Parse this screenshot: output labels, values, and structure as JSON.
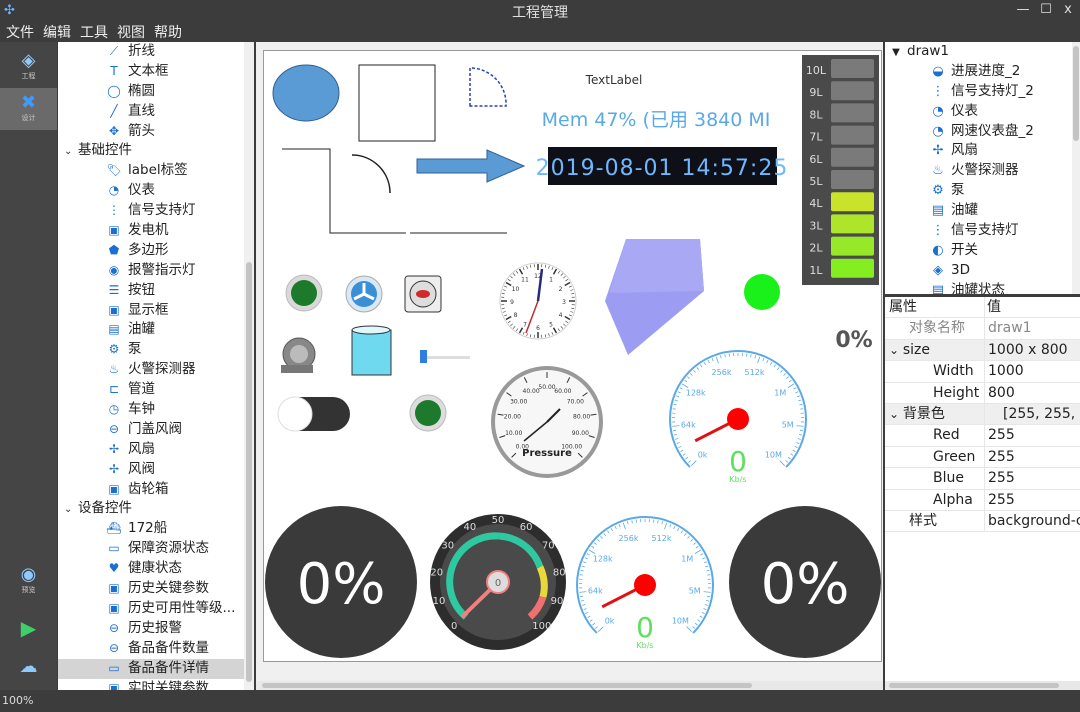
{
  "window": {
    "title": "工程管理",
    "minimize": "—",
    "maximize": "☐",
    "close": "x"
  },
  "menu": [
    "文件",
    "编辑",
    "工具",
    "视图",
    "帮助"
  ],
  "leftbar": {
    "project_label": "工程",
    "design_label": "设计",
    "preview_label": "预览"
  },
  "toolbox": {
    "items": [
      {
        "label": "折线",
        "icon": "polyline-icon",
        "glyph": "⟋"
      },
      {
        "label": "文本框",
        "icon": "textbox-icon",
        "glyph": "T"
      },
      {
        "label": "椭圆",
        "icon": "ellipse-icon",
        "glyph": "◯"
      },
      {
        "label": "直线",
        "icon": "line-icon",
        "glyph": "╱"
      },
      {
        "label": "箭头",
        "icon": "arrow-icon",
        "glyph": "✥"
      }
    ],
    "basic_category": "基础控件",
    "basic_items": [
      {
        "label": "label标签",
        "icon": "tag-icon",
        "glyph": "🏷"
      },
      {
        "label": "仪表",
        "icon": "gauge-icon",
        "glyph": "◔"
      },
      {
        "label": "信号支持灯",
        "icon": "signal-light-icon",
        "glyph": "⋮"
      },
      {
        "label": "发电机",
        "icon": "generator-icon",
        "glyph": "▣"
      },
      {
        "label": "多边形",
        "icon": "polygon-icon",
        "glyph": "⬟"
      },
      {
        "label": "报警指示灯",
        "icon": "alarm-light-icon",
        "glyph": "◉"
      },
      {
        "label": "按钮",
        "icon": "button-list-icon",
        "glyph": "☰"
      },
      {
        "label": "显示框",
        "icon": "display-box-icon",
        "glyph": "▣"
      },
      {
        "label": "油罐",
        "icon": "tank-icon",
        "glyph": "▤"
      },
      {
        "label": "泵",
        "icon": "pump-icon",
        "glyph": "⚙"
      },
      {
        "label": "火警探测器",
        "icon": "fire-icon",
        "glyph": "♨"
      },
      {
        "label": "管道",
        "icon": "pipe-icon",
        "glyph": "⊏"
      },
      {
        "label": "车钟",
        "icon": "clock-icon",
        "glyph": "◷"
      },
      {
        "label": "门盖风阀",
        "icon": "damper-icon",
        "glyph": "⊖"
      },
      {
        "label": "风扇",
        "icon": "fan-icon",
        "glyph": "✢"
      },
      {
        "label": "风阀",
        "icon": "valve-icon",
        "glyph": "✢"
      },
      {
        "label": "齿轮箱",
        "icon": "gearbox-icon",
        "glyph": "▣"
      }
    ],
    "device_category": "设备控件",
    "device_items": [
      {
        "label": "172船",
        "icon": "ship-icon",
        "glyph": "⛴"
      },
      {
        "label": "保障资源状态",
        "icon": "chart-icon",
        "glyph": "▭"
      },
      {
        "label": "健康状态",
        "icon": "heart-icon",
        "glyph": "♥"
      },
      {
        "label": "历史关键参数",
        "icon": "history-icon",
        "glyph": "▣"
      },
      {
        "label": "历史可用性等级...",
        "icon": "history-icon",
        "glyph": "▣"
      },
      {
        "label": "历史报警",
        "icon": "alarm-history-icon",
        "glyph": "⊖"
      },
      {
        "label": "备品备件数量",
        "icon": "spare-count-icon",
        "glyph": "⊖"
      },
      {
        "label": "备品备件详情",
        "icon": "spare-detail-icon",
        "glyph": "▭"
      },
      {
        "label": "实时关键参数",
        "icon": "realtime-icon",
        "glyph": "▣"
      }
    ]
  },
  "canvas": {
    "text_label": "TextLabel",
    "mem_text": "Mem 47% (已用 3840 MI",
    "digital_clock": "2019-08-01 14:57:25",
    "led_levels": [
      "10L",
      "9L",
      "8L",
      "7L",
      "6L",
      "5L",
      "4L",
      "3L",
      "2L",
      "1L"
    ],
    "led_active_from": 4,
    "percent_small": "0%",
    "pressure": {
      "label": "Pressure",
      "ticks": [
        "0.00",
        "10.00",
        "20.00",
        "30.00",
        "40.00",
        "50.00",
        "60.00",
        "70.00",
        "80.00",
        "90.00",
        "100.00"
      ]
    },
    "speed_gauge": {
      "ticks": [
        "0k",
        "64k",
        "128k",
        "256k",
        "512k",
        "1M",
        "5M",
        "10M"
      ],
      "value": "0",
      "unit": "Kb/s"
    },
    "dial_gauge": {
      "ticks": [
        "0",
        "10",
        "20",
        "30",
        "40",
        "50",
        "60",
        "70",
        "80",
        "90",
        "100"
      ],
      "value": "0"
    },
    "circle_percent": "0%"
  },
  "object_tree": {
    "root": "draw1",
    "items": [
      {
        "label": "进展进度_2",
        "icon": "progress-icon",
        "glyph": "◒"
      },
      {
        "label": "信号支持灯_2",
        "icon": "signal-light-icon",
        "glyph": "⋮"
      },
      {
        "label": "仪表",
        "icon": "gauge-icon",
        "glyph": "◔"
      },
      {
        "label": "网速仪表盘_2",
        "icon": "speed-gauge-icon",
        "glyph": "◔"
      },
      {
        "label": "风扇",
        "icon": "fan-icon",
        "glyph": "✢"
      },
      {
        "label": "火警探测器",
        "icon": "fire-icon",
        "glyph": "♨"
      },
      {
        "label": "泵",
        "icon": "pump-icon",
        "glyph": "⚙"
      },
      {
        "label": "油罐",
        "icon": "tank-icon",
        "glyph": "▤"
      },
      {
        "label": "信号支持灯",
        "icon": "signal-light-icon",
        "glyph": "⋮"
      },
      {
        "label": "开关",
        "icon": "switch-icon",
        "glyph": "◐"
      },
      {
        "label": "3D",
        "icon": "3d-icon",
        "glyph": "◈"
      },
      {
        "label": "油罐状态",
        "icon": "tank-status-icon",
        "glyph": "▤"
      }
    ]
  },
  "properties": {
    "header_key": "属性",
    "header_value": "值",
    "rows": [
      {
        "key": "对象名称",
        "value": "draw1",
        "indent": 1,
        "muted": true
      },
      {
        "key": "size",
        "value": "1000 x 800",
        "indent": 0,
        "group": true
      },
      {
        "key": "Width",
        "value": "1000",
        "indent": 2
      },
      {
        "key": "Height",
        "value": "800",
        "indent": 2
      },
      {
        "key": "背景色",
        "value": "[255, 255, 2",
        "indent": 0,
        "group": true
      },
      {
        "key": "Red",
        "value": "255",
        "indent": 2
      },
      {
        "key": "Green",
        "value": "255",
        "indent": 2
      },
      {
        "key": "Blue",
        "value": "255",
        "indent": 2
      },
      {
        "key": "Alpha",
        "value": "255",
        "indent": 2
      },
      {
        "key": "样式",
        "value": "background-c",
        "indent": 1
      }
    ]
  },
  "status": {
    "zoom": "100%"
  },
  "colors": {
    "accent": "#1a6fd1",
    "led_on": "#9fe03a",
    "led_off": "#7a7a7a",
    "dark_circle": "#3a3a3a"
  }
}
